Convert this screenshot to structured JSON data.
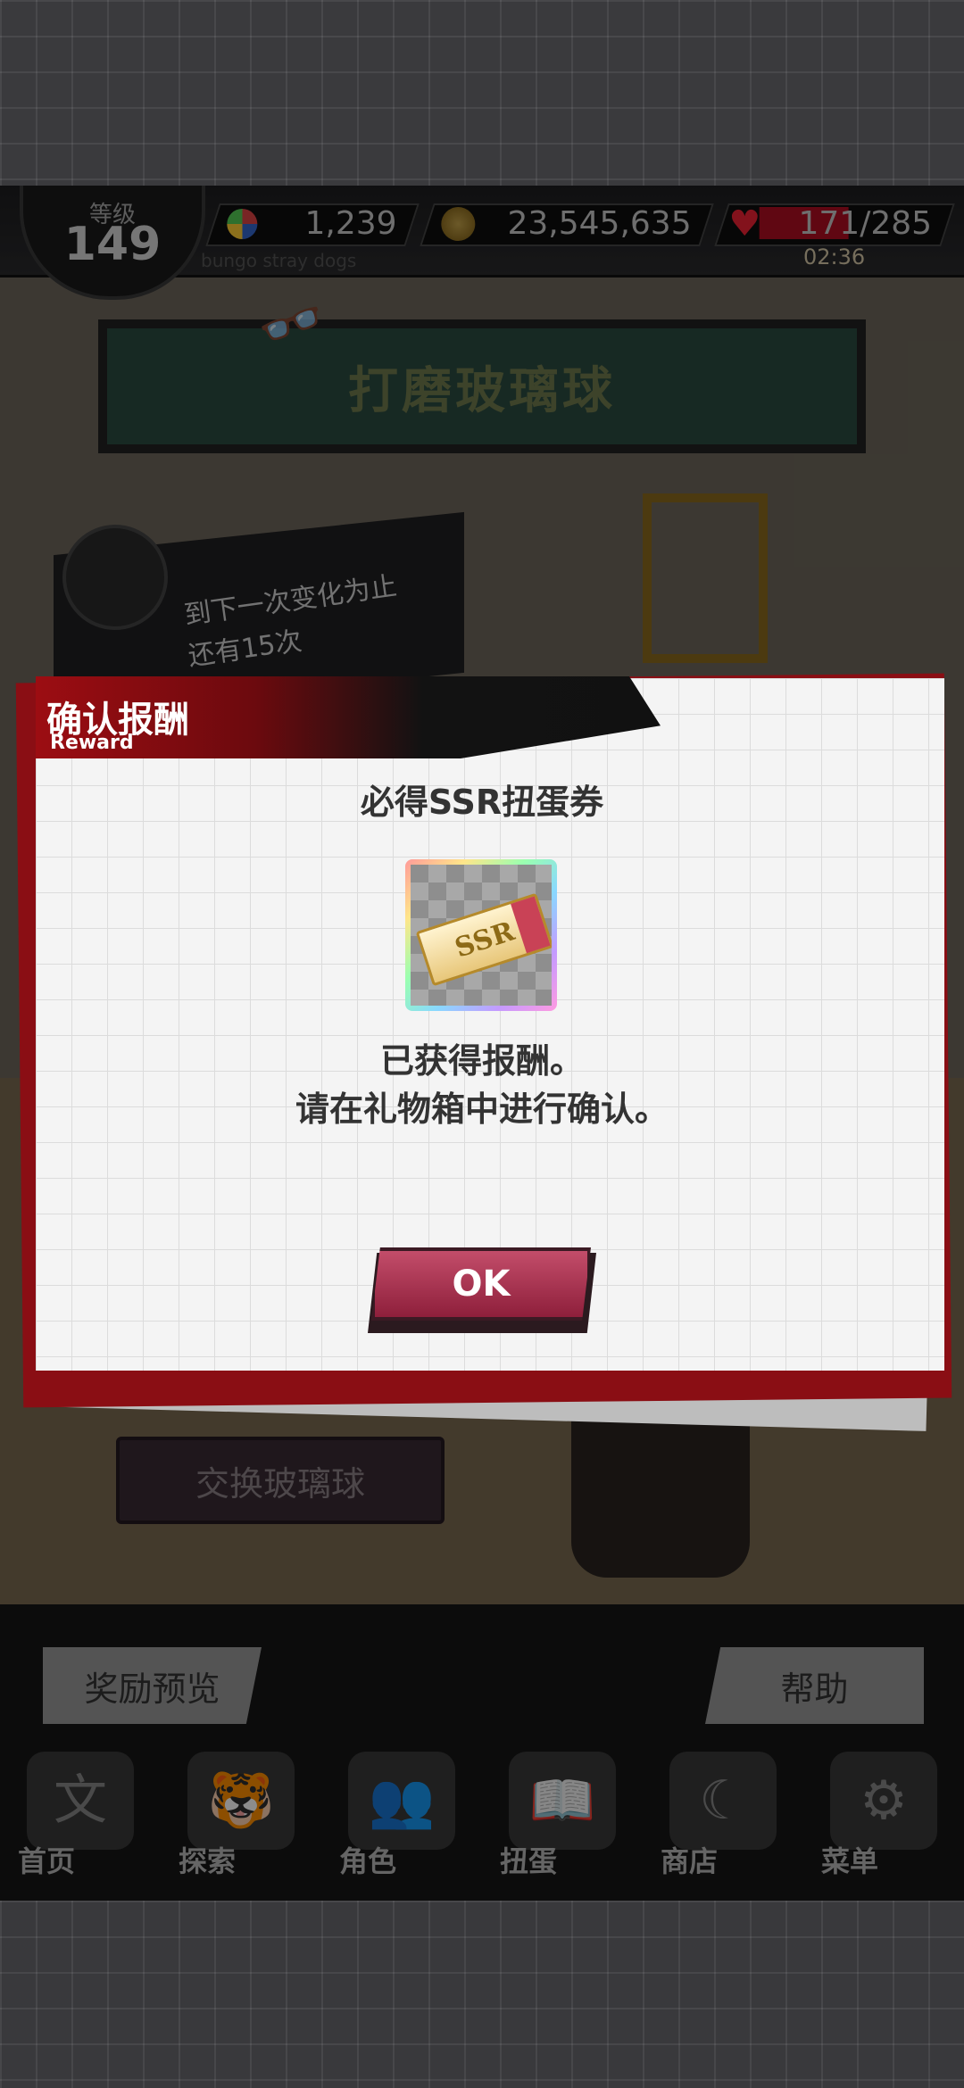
{
  "status": {
    "level_label": "等级",
    "level_value": "149",
    "gems": "1,239",
    "coins": "23,545,635",
    "hp": "171/285",
    "hp_timer": "02:36",
    "subtitle": "bungo stray dogs"
  },
  "background": {
    "title": "打磨玻璃球",
    "progress_line1": "到下一次变化为止",
    "progress_line2": "还有15次",
    "exchange_label": "交换玻璃球",
    "preview_label": "奖励预览",
    "help_label": "帮助"
  },
  "nav": {
    "items": [
      {
        "label": "首页",
        "icon": "bungo-home-icon"
      },
      {
        "label": "探索",
        "icon": "tiger-icon"
      },
      {
        "label": "角色",
        "icon": "people-icon"
      },
      {
        "label": "扭蛋",
        "icon": "book-icon"
      },
      {
        "label": "商店",
        "icon": "crescent-icon"
      },
      {
        "label": "菜单",
        "icon": "gear-icon"
      }
    ]
  },
  "modal": {
    "title": "确认报酬",
    "subtitle": "Reward",
    "reward_name": "必得SSR扭蛋券",
    "ticket_text": "SSR",
    "message_line1": "已获得报酬。",
    "message_line2": "请在礼物箱中进行确认。",
    "ok_label": "OK"
  },
  "colors": {
    "accent_red": "#9c0d12",
    "ok_button": "#a3304e",
    "hp_bar": "#b00d22"
  }
}
